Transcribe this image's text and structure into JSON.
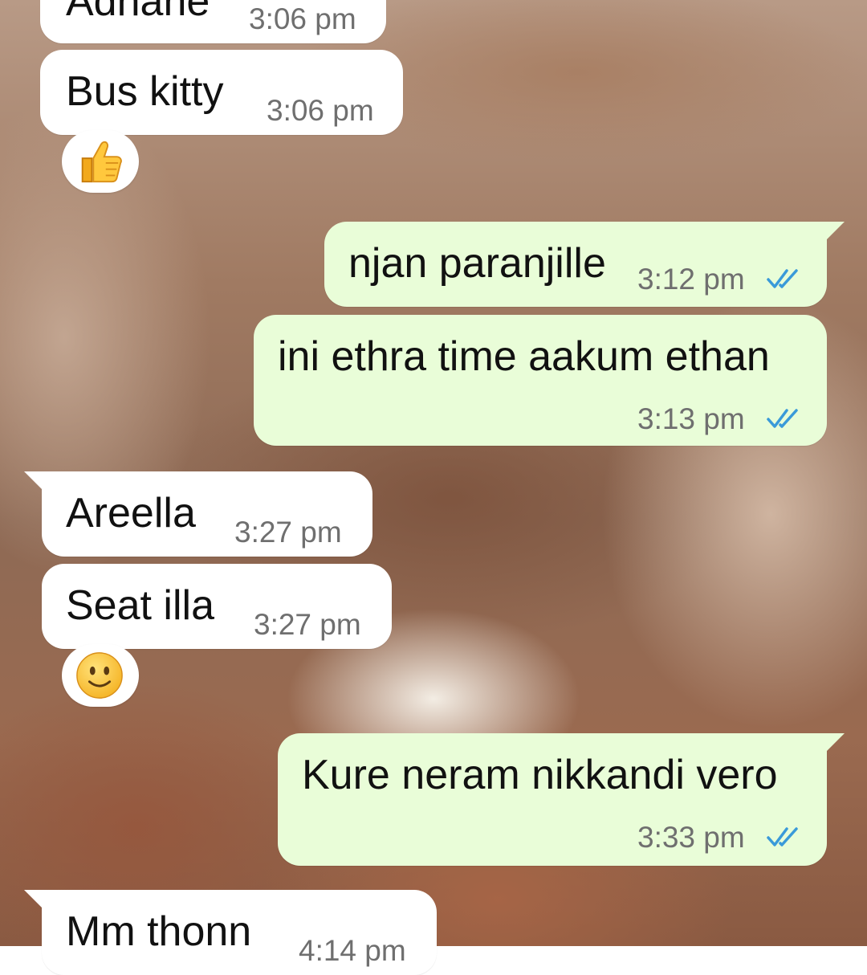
{
  "theme": {
    "incoming_bubble": "#ffffff",
    "outgoing_bubble": "#e9fdd8",
    "read_tick_color": "#3a9ad9",
    "timestamp_color": "#6f6f6f"
  },
  "messages": [
    {
      "direction": "incoming",
      "text": "Adhane",
      "time": "3:06 pm"
    },
    {
      "direction": "incoming",
      "text": "Bus kitty",
      "time": "3:06 pm",
      "reaction": "thumbs-up-icon"
    },
    {
      "direction": "outgoing",
      "text": "njan paranjille",
      "time": "3:12 pm",
      "status": "read"
    },
    {
      "direction": "outgoing",
      "text": "ini ethra time aakum ethan",
      "time": "3:13 pm",
      "status": "read"
    },
    {
      "direction": "incoming",
      "text": "Areella",
      "time": "3:27 pm"
    },
    {
      "direction": "incoming",
      "text": "Seat illa",
      "time": "3:27 pm",
      "reaction": "smiling-face-icon"
    },
    {
      "direction": "outgoing",
      "text": "Kure neram nikkandi vero",
      "time": "3:33 pm",
      "status": "read"
    },
    {
      "direction": "incoming",
      "text": "Mm thonn",
      "time": "4:14 pm"
    }
  ]
}
